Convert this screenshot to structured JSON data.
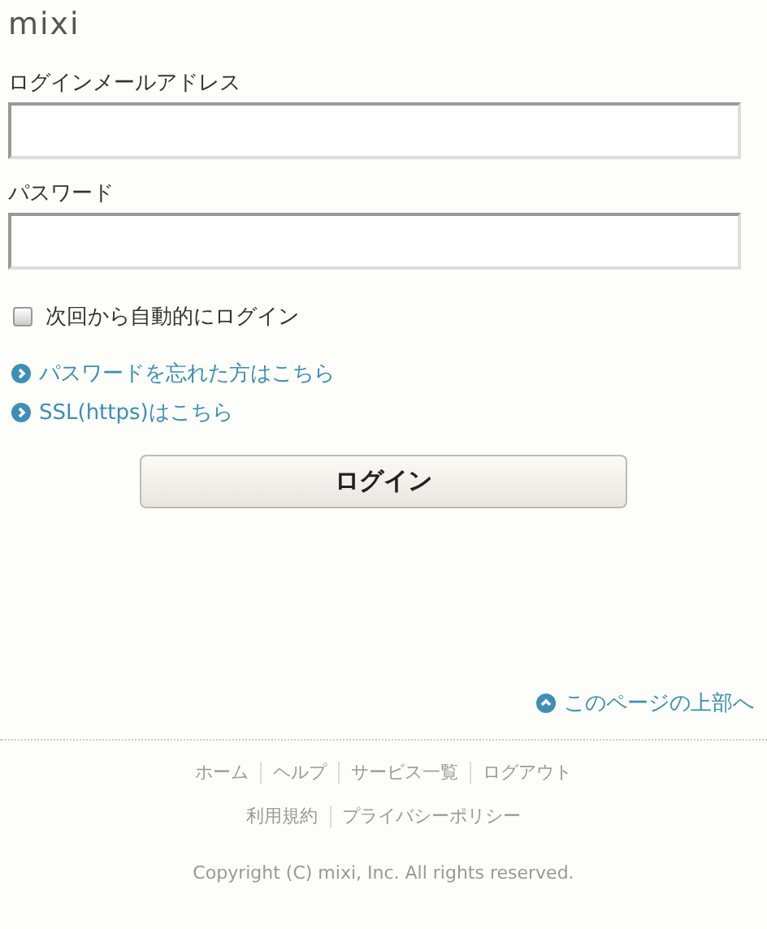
{
  "logo": "mixi",
  "fields": [
    {
      "label": "ログインメールアドレス"
    },
    {
      "label": "パスワード"
    }
  ],
  "remember": {
    "label": "次回から自動的にログイン",
    "checked": false
  },
  "links": [
    "パスワードを忘れた方はこちら",
    "SSL(https)はこちら"
  ],
  "login_button": "ログイン",
  "page_top": "このページの上部へ",
  "footer_links": [
    [
      "ホーム",
      "ヘルプ",
      "サービス一覧",
      "ログアウト"
    ],
    [
      "利用規約",
      "プライバシーポリシー"
    ]
  ],
  "copyright": "Copyright (C) mixi, Inc. All rights reserved."
}
